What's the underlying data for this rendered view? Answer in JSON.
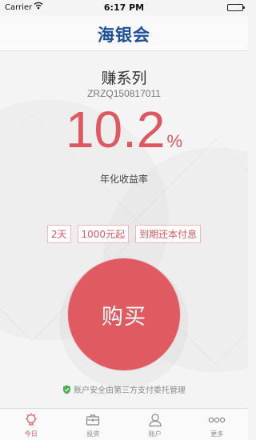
{
  "status_bar": {
    "carrier": "Carrier",
    "time": "6:17 PM",
    "battery_level": 1.0
  },
  "header": {
    "logo": "海银会"
  },
  "product": {
    "name": "赚系列",
    "code": "ZRZQ150817011",
    "rate_value": "10.2",
    "rate_unit": "%",
    "rate_label": "年化收益率",
    "tags": [
      "2天",
      "1000元起",
      "到期还本付息"
    ]
  },
  "buy_button": {
    "label": "购买"
  },
  "security_note": "账户安全由第三方支付委托管理",
  "tabbar": {
    "items": [
      {
        "label": "今日",
        "icon": "lightbulb-icon",
        "active": true
      },
      {
        "label": "投资",
        "icon": "briefcase-icon",
        "active": false
      },
      {
        "label": "账户",
        "icon": "user-icon",
        "active": false
      },
      {
        "label": "更多",
        "icon": "more-icon",
        "active": false
      }
    ]
  },
  "colors": {
    "accent": "#e0585f",
    "logo": "#1e4f9b",
    "security": "#4caf50"
  }
}
